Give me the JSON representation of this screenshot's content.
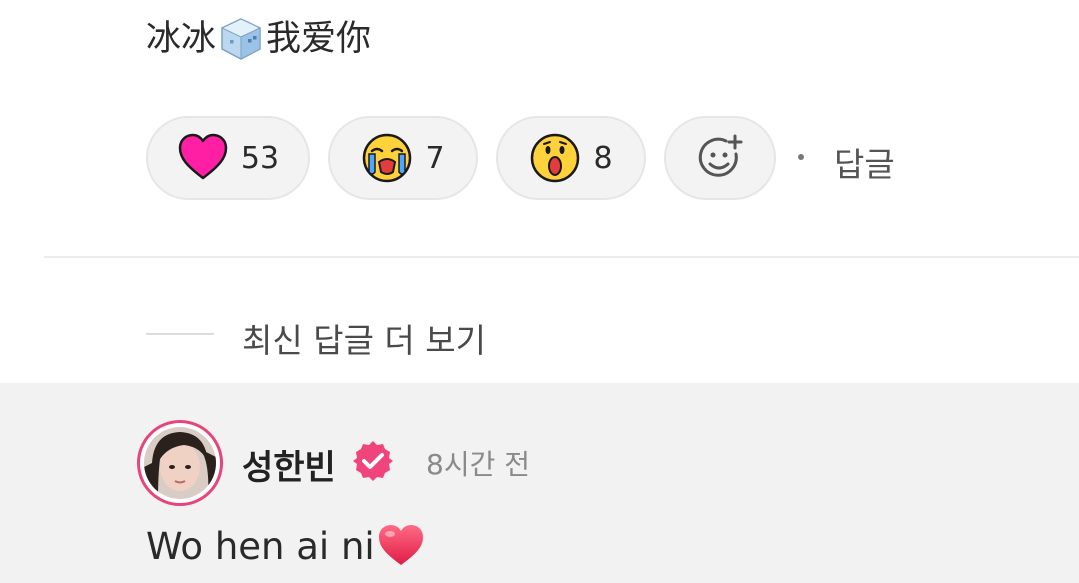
{
  "comment": {
    "text_before": "冰冰",
    "inline_icon": "ice-cube-icon",
    "text_after": "我爱你"
  },
  "reactions": [
    {
      "icon": "heart-icon",
      "count": "53",
      "color": "#ff1493"
    },
    {
      "icon": "crying-face-icon",
      "count": "7",
      "color": "#ffd23c"
    },
    {
      "icon": "shocked-face-icon",
      "count": "8",
      "color": "#ffd23c"
    },
    {
      "icon": "add-reaction-icon"
    }
  ],
  "reply_link": "답글",
  "more_replies": "최신 답글 더 보기",
  "reply": {
    "author": "성한빈",
    "verified_badge": "verified-icon",
    "timestamp": "8시간 전",
    "text": "Wo hen ai ni",
    "inline_icon": "red-heart-icon",
    "accent": "#e7447a"
  }
}
